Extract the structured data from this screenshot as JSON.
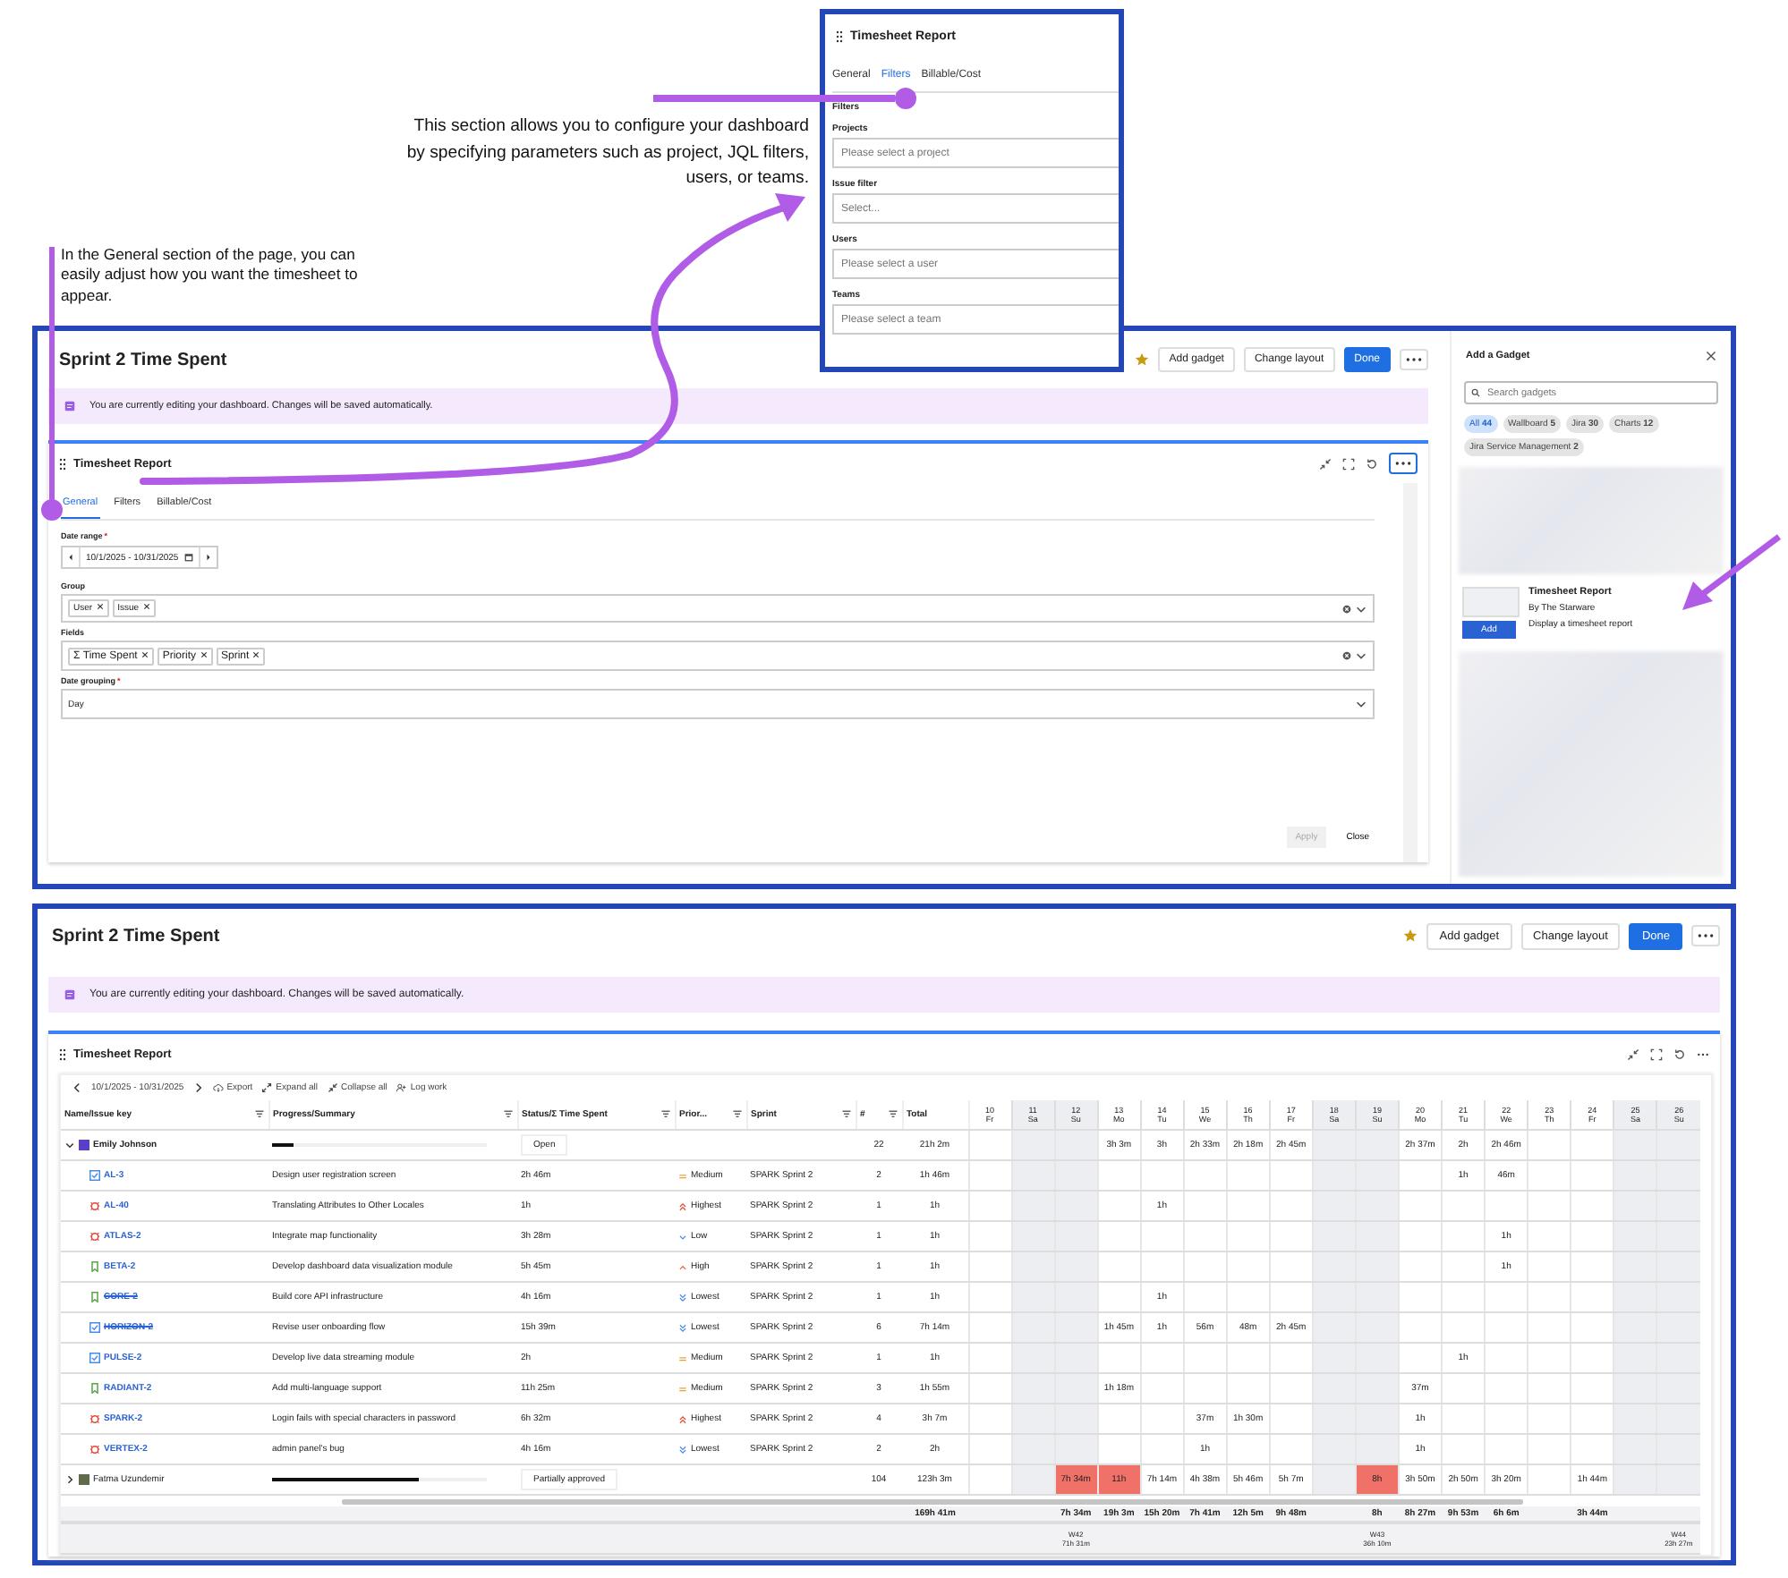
{
  "annotations": [
    {
      "text": "This section allows you to configure your dashboard by specifying parameters such as project, JQL filters, users, or teams."
    },
    {
      "text": "In the General section of the page, you can easily adjust how you want the timesheet to appear."
    }
  ],
  "filters_popup": {
    "title": "Timesheet Report",
    "tabs": [
      {
        "label": "General",
        "selected": false
      },
      {
        "label": "Filters",
        "selected": true
      },
      {
        "label": "Billable/Cost",
        "selected": false
      }
    ],
    "section": "Filters",
    "fields": [
      {
        "label": "Projects",
        "placeholder": "Please select a project"
      },
      {
        "label": "Issue filter",
        "placeholder": "Select..."
      },
      {
        "label": "Users",
        "placeholder": "Please select a user"
      },
      {
        "label": "Teams",
        "placeholder": "Please select a team"
      }
    ]
  },
  "edit_view": {
    "title": "Sprint 2 Time Spent",
    "starred": true,
    "buttons": {
      "add_gadget": "Add gadget",
      "change_layout": "Change layout",
      "done": "Done"
    },
    "notice": "You are currently editing your dashboard. Changes will be saved automatically.",
    "gadget": {
      "title": "Timesheet Report",
      "tabs": [
        {
          "label": "General",
          "selected": true
        },
        {
          "label": "Filters",
          "selected": false
        },
        {
          "label": "Billable/Cost",
          "selected": false
        }
      ],
      "fields": [
        {
          "label": "Date range",
          "required_mark": "*",
          "kind": "daterange",
          "value": "10/1/2025 - 10/31/2025"
        },
        {
          "label": "Group",
          "kind": "tags",
          "tags": [
            "User",
            "Issue"
          ]
        },
        {
          "label": "Fields",
          "kind": "tags",
          "tags": [
            "Σ Time Spent",
            "Priority",
            "Sprint"
          ]
        },
        {
          "label": "Date grouping",
          "required_mark": "*",
          "kind": "select",
          "value": "Day"
        }
      ],
      "apply": {
        "label": "Apply",
        "disabled": true
      },
      "close": "Close"
    },
    "sidebar": {
      "title": "Add a Gadget",
      "search_placeholder": "Search gadgets",
      "chips": [
        {
          "label": "All",
          "count": "44",
          "selected": true
        },
        {
          "label": "Wallboard",
          "count": "5",
          "selected": false
        },
        {
          "label": "Jira",
          "count": "30",
          "selected": false
        },
        {
          "label": "Charts",
          "count": "12",
          "selected": false
        },
        {
          "label": "Jira Service Management",
          "count": "2",
          "selected": false
        }
      ],
      "item": {
        "name": "Timesheet Report",
        "vendor": "By The Starware",
        "description": "Display a timesheet report",
        "button": "Add"
      }
    }
  },
  "report_view": {
    "title": "Sprint 2 Time Spent",
    "starred": true,
    "buttons": {
      "add_gadget": "Add gadget",
      "change_layout": "Change layout",
      "done": "Done"
    },
    "notice": "You are currently editing your dashboard. Changes will be saved automatically.",
    "gadget_title": "Timesheet Report",
    "toolbar": {
      "range": "10/1/2025 - 10/31/2025",
      "export": "Export",
      "expand_all": "Expand all",
      "collapse_all": "Collapse all",
      "log_work": "Log work"
    },
    "columns": [
      {
        "label": "Name/Issue key",
        "filter": true
      },
      {
        "label": "Progress/Summary",
        "filter": true
      },
      {
        "label": "Status/Σ Time Spent",
        "filter": true
      },
      {
        "label": "Prior...",
        "filter": true
      },
      {
        "label": "Sprint",
        "filter": true
      },
      {
        "label": "#",
        "filter": true
      },
      {
        "label": "Total",
        "filter": false
      }
    ],
    "days": [
      {
        "num": "10",
        "dow": "Fr",
        "weekend": false
      },
      {
        "num": "11",
        "dow": "Sa",
        "weekend": true
      },
      {
        "num": "12",
        "dow": "Su",
        "weekend": true,
        "total": "7h 34m",
        "week": {
          "label": "W42",
          "total": "71h 31m"
        }
      },
      {
        "num": "13",
        "dow": "Mo",
        "weekend": false,
        "total": "19h 3m"
      },
      {
        "num": "14",
        "dow": "Tu",
        "weekend": false,
        "total": "15h 20m"
      },
      {
        "num": "15",
        "dow": "We",
        "weekend": false,
        "total": "7h 41m"
      },
      {
        "num": "16",
        "dow": "Th",
        "weekend": false,
        "total": "12h 5m"
      },
      {
        "num": "17",
        "dow": "Fr",
        "weekend": false,
        "total": "9h 48m"
      },
      {
        "num": "18",
        "dow": "Sa",
        "weekend": true
      },
      {
        "num": "19",
        "dow": "Su",
        "weekend": true,
        "total": "8h",
        "week": {
          "label": "W43",
          "total": "36h 10m"
        }
      },
      {
        "num": "20",
        "dow": "Mo",
        "weekend": false,
        "total": "8h 27m"
      },
      {
        "num": "21",
        "dow": "Tu",
        "weekend": false,
        "total": "9h 53m"
      },
      {
        "num": "22",
        "dow": "We",
        "weekend": false,
        "total": "6h 6m"
      },
      {
        "num": "23",
        "dow": "Th",
        "weekend": false
      },
      {
        "num": "24",
        "dow": "Fr",
        "weekend": false,
        "total": "3h 44m"
      },
      {
        "num": "25",
        "dow": "Sa",
        "weekend": true
      },
      {
        "num": "26",
        "dow": "Su",
        "weekend": true,
        "week": {
          "label": "W44",
          "total": "23h 27m"
        }
      }
    ],
    "grand_total": "169h 41m",
    "rows": [
      {
        "kind": "user",
        "name": "Emily Johnson",
        "expanded": true,
        "level": 0.1,
        "status": "Open",
        "count": "22",
        "total": "21h 2m",
        "cells": [
          {},
          {},
          {},
          {
            "value": "3h 3m",
            "over": false
          },
          {
            "value": "3h",
            "over": false
          },
          {
            "value": "2h 33m",
            "over": false
          },
          {
            "value": "2h 18m",
            "over": false
          },
          {
            "value": "2h 45m",
            "over": false
          },
          {},
          {},
          {
            "value": "2h 37m",
            "over": false
          },
          {
            "value": "2h",
            "over": false
          },
          {
            "value": "2h 46m",
            "over": false
          },
          {},
          {},
          {},
          {}
        ]
      },
      {
        "kind": "issue",
        "key": "AL-3",
        "icon": {
          "kind": "task"
        },
        "done": false,
        "summary": "Design user registration screen",
        "time": "2h 46m",
        "priority": {
          "label": "Medium",
          "kind": "medium"
        },
        "sprint": "SPARK Sprint 2",
        "count": "2",
        "total": "1h 46m",
        "cells": [
          {},
          {},
          {},
          {},
          {},
          {},
          {},
          {},
          {},
          {},
          {},
          {
            "value": "1h",
            "over": false
          },
          {
            "value": "46m",
            "over": false
          },
          {},
          {},
          {},
          {}
        ]
      },
      {
        "kind": "issue",
        "key": "AL-40",
        "icon": {
          "kind": "bug"
        },
        "done": false,
        "summary": "Translating Attributes to Other Locales",
        "time": "1h",
        "priority": {
          "label": "Highest",
          "kind": "highest"
        },
        "sprint": "SPARK Sprint 2",
        "count": "1",
        "total": "1h",
        "cells": [
          {},
          {},
          {},
          {},
          {
            "value": "1h",
            "over": false
          },
          {},
          {},
          {},
          {},
          {},
          {},
          {},
          {},
          {},
          {},
          {},
          {}
        ]
      },
      {
        "kind": "issue",
        "key": "ATLAS-2",
        "icon": {
          "kind": "bug"
        },
        "done": false,
        "summary": "Integrate map functionality",
        "time": "3h 28m",
        "priority": {
          "label": "Low",
          "kind": "low"
        },
        "sprint": "SPARK Sprint 2",
        "count": "1",
        "total": "1h",
        "cells": [
          {},
          {},
          {},
          {},
          {},
          {},
          {},
          {},
          {},
          {},
          {},
          {},
          {
            "value": "1h",
            "over": false
          },
          {},
          {},
          {},
          {}
        ]
      },
      {
        "kind": "issue",
        "key": "BETA-2",
        "icon": {
          "kind": "story"
        },
        "done": false,
        "summary": "Develop dashboard data visualization module",
        "time": "5h 45m",
        "priority": {
          "label": "High",
          "kind": "high"
        },
        "sprint": "SPARK Sprint 2",
        "count": "1",
        "total": "1h",
        "cells": [
          {},
          {},
          {},
          {},
          {},
          {},
          {},
          {},
          {},
          {},
          {},
          {},
          {
            "value": "1h",
            "over": false
          },
          {},
          {},
          {},
          {}
        ]
      },
      {
        "kind": "issue",
        "key": "CORE-2",
        "icon": {
          "kind": "story"
        },
        "done": true,
        "summary": "Build core API infrastructure",
        "time": "4h 16m",
        "priority": {
          "label": "Lowest",
          "kind": "lowest"
        },
        "sprint": "SPARK Sprint 2",
        "count": "1",
        "total": "1h",
        "cells": [
          {},
          {},
          {},
          {},
          {
            "value": "1h",
            "over": false
          },
          {},
          {},
          {},
          {},
          {},
          {},
          {},
          {},
          {},
          {},
          {},
          {}
        ]
      },
      {
        "kind": "issue",
        "key": "HORIZON-2",
        "icon": {
          "kind": "task"
        },
        "done": true,
        "summary": "Revise user onboarding flow",
        "time": "15h 39m",
        "priority": {
          "label": "Lowest",
          "kind": "lowest"
        },
        "sprint": "SPARK Sprint 2",
        "count": "6",
        "total": "7h 14m",
        "cells": [
          {},
          {},
          {},
          {
            "value": "1h 45m",
            "over": false
          },
          {
            "value": "1h",
            "over": false
          },
          {
            "value": "56m",
            "over": false
          },
          {
            "value": "48m",
            "over": false
          },
          {
            "value": "2h 45m",
            "over": false
          },
          {},
          {},
          {},
          {},
          {},
          {},
          {},
          {},
          {}
        ]
      },
      {
        "kind": "issue",
        "key": "PULSE-2",
        "icon": {
          "kind": "task"
        },
        "done": false,
        "summary": "Develop live data streaming module",
        "time": "2h",
        "priority": {
          "label": "Medium",
          "kind": "medium"
        },
        "sprint": "SPARK Sprint 2",
        "count": "1",
        "total": "1h",
        "cells": [
          {},
          {},
          {},
          {},
          {},
          {},
          {},
          {},
          {},
          {},
          {},
          {
            "value": "1h",
            "over": false
          },
          {},
          {},
          {},
          {},
          {}
        ]
      },
      {
        "kind": "issue",
        "key": "RADIANT-2",
        "icon": {
          "kind": "story"
        },
        "done": false,
        "summary": "Add multi-language support",
        "time": "11h 25m",
        "priority": {
          "label": "Medium",
          "kind": "medium"
        },
        "sprint": "SPARK Sprint 2",
        "count": "3",
        "total": "1h 55m",
        "cells": [
          {},
          {},
          {},
          {
            "value": "1h 18m",
            "over": false
          },
          {},
          {},
          {},
          {},
          {},
          {},
          {
            "value": "37m",
            "over": false
          },
          {},
          {},
          {},
          {},
          {},
          {}
        ]
      },
      {
        "kind": "issue",
        "key": "SPARK-2",
        "icon": {
          "kind": "bug"
        },
        "done": false,
        "summary": "Login fails with special characters in password",
        "time": "6h 32m",
        "priority": {
          "label": "Highest",
          "kind": "highest"
        },
        "sprint": "SPARK Sprint 2",
        "count": "4",
        "total": "3h 7m",
        "cells": [
          {},
          {},
          {},
          {},
          {},
          {
            "value": "37m",
            "over": false
          },
          {
            "value": "1h 30m",
            "over": false
          },
          {},
          {},
          {},
          {
            "value": "1h",
            "over": false
          },
          {},
          {},
          {},
          {},
          {},
          {}
        ]
      },
      {
        "kind": "issue",
        "key": "VERTEX-2",
        "icon": {
          "kind": "bug"
        },
        "done": false,
        "summary": "admin panel's bug",
        "time": "4h 16m",
        "priority": {
          "label": "Lowest",
          "kind": "lowest"
        },
        "sprint": "SPARK Sprint 2",
        "count": "2",
        "total": "2h",
        "cells": [
          {},
          {},
          {},
          {},
          {},
          {
            "value": "1h",
            "over": false
          },
          {},
          {},
          {},
          {},
          {
            "value": "1h",
            "over": false
          },
          {},
          {},
          {},
          {},
          {},
          {}
        ]
      },
      {
        "kind": "user",
        "name": "Fatma Uzundemir",
        "expanded": false,
        "level": 0.68,
        "status": "Partially approved",
        "count": "104",
        "total": "123h 3m",
        "cells": [
          {},
          {},
          {
            "value": "7h 34m",
            "over": true
          },
          {
            "value": "11h",
            "over": true
          },
          {
            "value": "7h 14m",
            "over": false
          },
          {
            "value": "4h 38m",
            "over": false
          },
          {
            "value": "5h 46m",
            "over": false
          },
          {
            "value": "5h 7m",
            "over": false
          },
          {},
          {
            "value": "8h",
            "over": true
          },
          {
            "value": "3h 50m",
            "over": false
          },
          {
            "value": "2h 50m",
            "over": false
          },
          {
            "value": "3h 20m",
            "over": false
          },
          {},
          {
            "value": "1h 44m",
            "over": false
          },
          {},
          {}
        ]
      }
    ]
  }
}
